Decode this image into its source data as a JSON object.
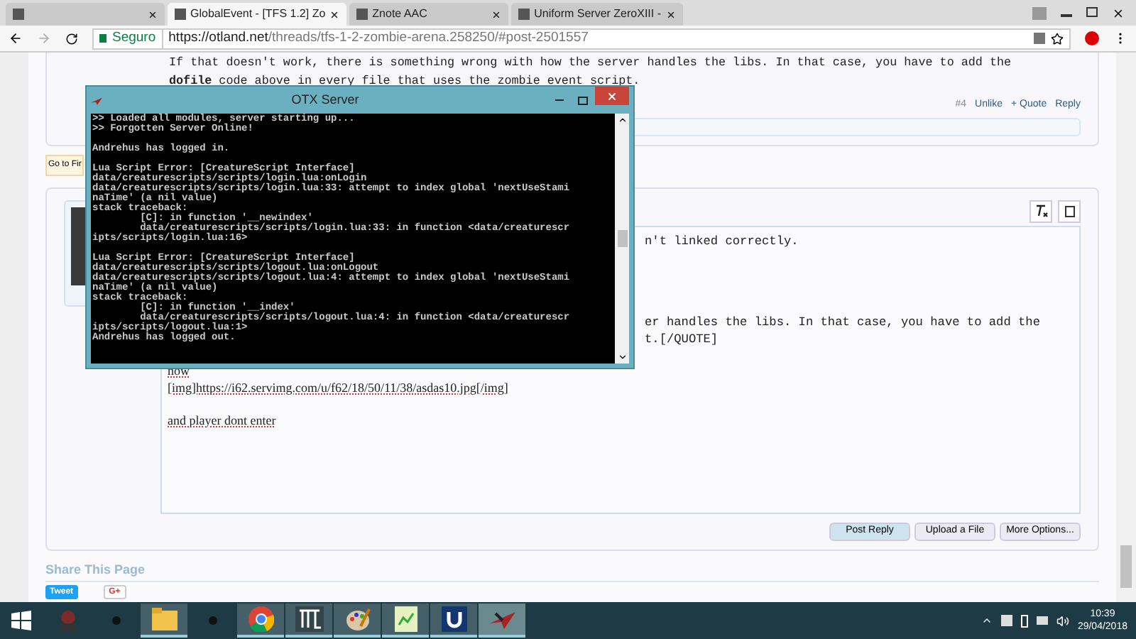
{
  "browser": {
    "tabs": [
      {
        "selected": false
      },
      {
        "title": "GlobalEvent - [TFS 1.2] Zo",
        "selected": true
      },
      {
        "title": "Znote AAC",
        "selected": false
      },
      {
        "title": "Uniform Server ZeroXIII -",
        "selected": false
      }
    ],
    "address": {
      "secure_label": "Seguro",
      "url_host": "https://otland.net",
      "url_path": "/threads/tfs-1-2-zombie-arena.258250/#post-2501557"
    }
  },
  "page": {
    "top_post": {
      "lines": [
        "If that doesn't work, there is something wrong with how the server handles the libs. In that case, you have to add the",
        "**dofile** code above in every file that uses the zombie event script."
      ],
      "actions": [
        "#4",
        "Unlike",
        "+ Quote",
        "Reply"
      ]
    },
    "go_to_first": "Go to Fir",
    "editor": {
      "quote_lines": [
        "n't linked correctly.",
        "er handles the libs. In that case, you have to add the",
        "t.[/QUOTE]"
      ],
      "lines": [
        "now",
        "[img]https://i62.servimg.com/u/f62/18/50/11/38/asdas10.jpg[/img]",
        "and player dont enter"
      ]
    },
    "buttons": [
      {
        "label": "Post Reply",
        "primary": true
      },
      {
        "label": "Upload a File",
        "primary": false
      },
      {
        "label": "More Options...",
        "primary": false
      }
    ],
    "share": {
      "heading": "Share This Page",
      "tweet": "Tweet",
      "gplus": "G+"
    }
  },
  "console": {
    "title": "OTX Server",
    "groups": [
      [
        ">> Loaded all modules, server starting up...",
        ">> Forgotten Server Online!"
      ],
      [
        "Andrehus has logged in."
      ],
      [
        "Lua Script Error: [CreatureScript Interface]",
        "data/creaturescripts/scripts/login.lua:onLogin",
        "data/creaturescripts/scripts/login.lua:33: attempt to index global 'nextUseStami",
        "naTime' (a nil value)",
        "stack traceback:",
        "        [C]: in function '__newindex'",
        "        data/creaturescripts/scripts/login.lua:33: in function <data/creaturescr",
        "ipts/scripts/login.lua:16>"
      ],
      [
        "Lua Script Error: [CreatureScript Interface]",
        "data/creaturescripts/scripts/logout.lua:onLogout",
        "data/creaturescripts/scripts/logout.lua:4: attempt to index global 'nextUseStami",
        "naTime' (a nil value)",
        "stack traceback:",
        "        [C]: in function '__index'",
        "        data/creaturescripts/scripts/logout.lua:4: in function <data/creaturescr",
        "ipts/scripts/logout.lua:1>",
        "Andrehus has logged out."
      ]
    ]
  },
  "taskbar": {
    "apps": [
      {
        "kind": "game",
        "running": false,
        "selected": false
      },
      {
        "kind": "dot",
        "running": false,
        "selected": false
      },
      {
        "kind": "folder",
        "running": true,
        "selected": false
      },
      {
        "kind": "dot",
        "running": false,
        "selected": false
      },
      {
        "kind": "chrome",
        "running": true,
        "selected": false
      },
      {
        "kind": "otc",
        "running": true,
        "selected": false
      },
      {
        "kind": "paint",
        "running": true,
        "selected": false
      },
      {
        "kind": "notepad",
        "running": true,
        "selected": false
      },
      {
        "kind": "uniform",
        "running": true,
        "selected": false
      },
      {
        "kind": "plane",
        "running": true,
        "selected": true
      }
    ],
    "time": "10:39",
    "date": "29/04/2018"
  }
}
